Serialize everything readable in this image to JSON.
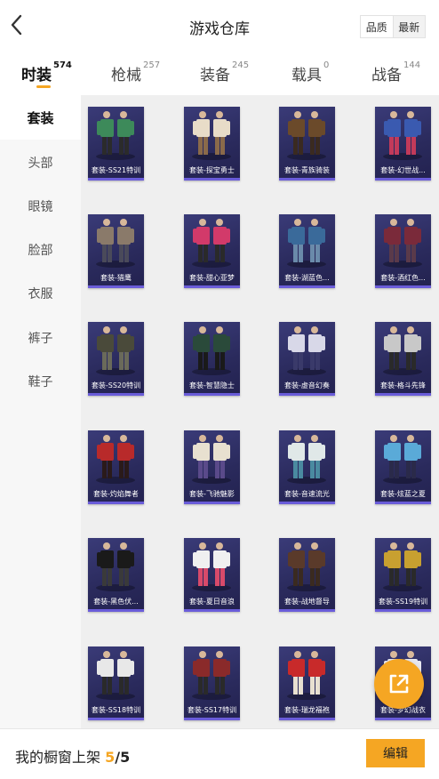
{
  "header": {
    "title": "游戏仓库",
    "sort_options": [
      "品质",
      "最新"
    ]
  },
  "tabs": [
    {
      "label": "时装",
      "count": "574"
    },
    {
      "label": "枪械",
      "count": "257"
    },
    {
      "label": "装备",
      "count": "245"
    },
    {
      "label": "载具",
      "count": "0"
    },
    {
      "label": "战备",
      "count": "144"
    }
  ],
  "sidebar": [
    "套装",
    "头部",
    "眼镜",
    "脸部",
    "衣服",
    "裤子",
    "鞋子"
  ],
  "items": [
    {
      "label": "套装-SS21特训",
      "colors": [
        "#3d8a5a",
        "#2b2b2b"
      ]
    },
    {
      "label": "套装-探宝勇士",
      "colors": [
        "#e8dcc8",
        "#8a6a4a"
      ]
    },
    {
      "label": "套装-青族骑装",
      "colors": [
        "#6b4a2a",
        "#3a2a20"
      ]
    },
    {
      "label": "套装-幻世战...",
      "colors": [
        "#3a5ab0",
        "#c23a5a"
      ]
    },
    {
      "label": "套装-猎鹰",
      "colors": [
        "#8a7a6a",
        "#4a4a5a"
      ]
    },
    {
      "label": "套装-甜心亚梦",
      "colors": [
        "#d23a6a",
        "#2a2a2a"
      ]
    },
    {
      "label": "套装-湖蓝色...",
      "colors": [
        "#3a6a9a",
        "#6a8aaa"
      ]
    },
    {
      "label": "套装-酒红色...",
      "colors": [
        "#7a2a3a",
        "#5a3a4a"
      ]
    },
    {
      "label": "套装-SS20特训",
      "colors": [
        "#4a4a3a",
        "#6a6a5a"
      ]
    },
    {
      "label": "套装-智慧隐士",
      "colors": [
        "#2a4a3a",
        "#1a1a1a"
      ]
    },
    {
      "label": "套装-虚音幻奏",
      "colors": [
        "#d8d8e8",
        "#3a3a6a"
      ]
    },
    {
      "label": "套装-格斗先锋",
      "colors": [
        "#c8c8c8",
        "#2a2a2a"
      ]
    },
    {
      "label": "套装-灼焰舞者",
      "colors": [
        "#b82a2a",
        "#2a1a1a"
      ]
    },
    {
      "label": "套装-飞驰魅影",
      "colors": [
        "#e8e0d0",
        "#5a4a8a"
      ]
    },
    {
      "label": "套装-音速流光",
      "colors": [
        "#e0e8e8",
        "#4a8aa0"
      ]
    },
    {
      "label": "套装-炫蓝之夏",
      "colors": [
        "#5aaad8",
        "#2a2a4a"
      ]
    },
    {
      "label": "套装-黑色伏...",
      "colors": [
        "#1a1a1a",
        "#3a3a3a"
      ]
    },
    {
      "label": "套装-夏日音浪",
      "colors": [
        "#f0f0f0",
        "#d84a6a"
      ]
    },
    {
      "label": "套装-战地督导",
      "colors": [
        "#5a3a2a",
        "#3a2a20"
      ]
    },
    {
      "label": "套装-SS19特训",
      "colors": [
        "#c8a030",
        "#2a2a2a"
      ]
    },
    {
      "label": "套装-SS18特训",
      "colors": [
        "#e8e8e8",
        "#2a2a2a"
      ]
    },
    {
      "label": "套装-SS17特训",
      "colors": [
        "#8a2a2a",
        "#2a2a2a"
      ]
    },
    {
      "label": "套装-瑞龙福袍",
      "colors": [
        "#c82a2a",
        "#e8e0d0"
      ]
    },
    {
      "label": "套装-梦幻战衣",
      "colors": [
        "#e8e8f0",
        "#8a8ad8"
      ]
    }
  ],
  "footer": {
    "label": "我的橱窗上架",
    "count": "5",
    "total": "/5",
    "edit_label": "编辑"
  }
}
